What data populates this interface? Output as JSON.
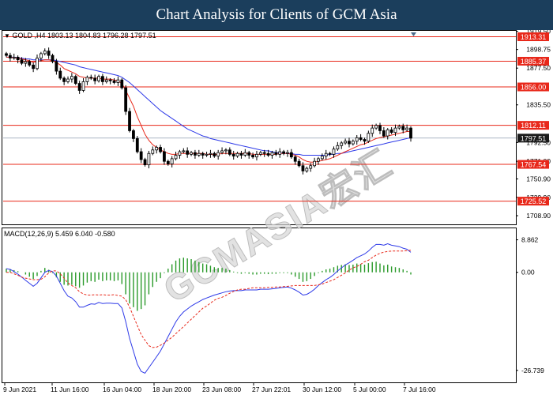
{
  "header": {
    "title": "Chart Analysis for Clients of GCM Asia"
  },
  "symbol_info": "GOLD ,H4  1803.13 1804.83 1796.28 1797.51",
  "macd_info": "MACD(12,26,9) 5.459 6.040 -0.580",
  "watermark": "GCMASIA宏汇",
  "colors": {
    "header_bg": "#1b3e5c",
    "level_line": "#e8281a",
    "level_tag": "#e8281a",
    "price_tag": "#1a1a1a",
    "ma_fast": "#e8281a",
    "ma_slow": "#2d39e8",
    "macd_hist": "#2a9a2a",
    "macd_line": "#2d39e8",
    "signal_line": "#e8281a",
    "candle": "#000000"
  },
  "chart_data": {
    "type": "candlestick",
    "price_axis": {
      "min": 1699,
      "max": 1921,
      "ticks": [
        "1919.50",
        "1898.75",
        "1877.50",
        "1835.50",
        "1792.50",
        "1771.00",
        "1750.90",
        "1729.90",
        "1708.90"
      ]
    },
    "levels": [
      1913.31,
      1885.37,
      1856.0,
      1812.11,
      1767.54,
      1725.52
    ],
    "current_price": 1797.51,
    "x_labels": [
      "9 Jun 2021",
      "11 Jun 16:00",
      "16 Jun 04:00",
      "18 Jun 20:00",
      "23 Jun 08:00",
      "27 Jun 22:01",
      "30 Jun 12:00",
      "5 Jul 00:00",
      "7 Jul 16:00"
    ],
    "close": [
      1892,
      1889,
      1890,
      1887,
      1883,
      1885,
      1881,
      1877,
      1889,
      1894,
      1897,
      1892,
      1885,
      1874,
      1866,
      1862,
      1865,
      1868,
      1860,
      1852,
      1862,
      1867,
      1866,
      1863,
      1868,
      1862,
      1864,
      1863,
      1861,
      1864,
      1855,
      1828,
      1806,
      1797,
      1782,
      1773,
      1767,
      1780,
      1784,
      1787,
      1782,
      1771,
      1768,
      1774,
      1778,
      1782,
      1783,
      1779,
      1781,
      1778,
      1780,
      1778,
      1779,
      1780,
      1777,
      1781,
      1783,
      1784,
      1779,
      1777,
      1780,
      1778,
      1781,
      1778,
      1776,
      1779,
      1781,
      1780,
      1778,
      1781,
      1779,
      1782,
      1780,
      1781,
      1776,
      1771,
      1766,
      1760,
      1763,
      1766,
      1771,
      1774,
      1777,
      1780,
      1779,
      1785,
      1789,
      1792,
      1794,
      1791,
      1794,
      1798,
      1796,
      1794,
      1803,
      1809,
      1812,
      1806,
      1800,
      1807,
      1804,
      1809,
      1811,
      1807,
      1809,
      1797.51
    ],
    "ma_fast": [
      1890,
      1890,
      1889,
      1889,
      1888,
      1887,
      1886,
      1884,
      1885,
      1886,
      1887,
      1887,
      1886,
      1884,
      1881,
      1877,
      1875,
      1873,
      1871,
      1868,
      1867,
      1866,
      1866,
      1866,
      1866,
      1865,
      1865,
      1865,
      1864,
      1863,
      1860,
      1852,
      1843,
      1834,
      1822,
      1812,
      1802,
      1795,
      1790,
      1787,
      1784,
      1782,
      1780,
      1779,
      1779,
      1780,
      1780,
      1780,
      1780,
      1780,
      1780,
      1780,
      1779,
      1779,
      1779,
      1779,
      1780,
      1780,
      1780,
      1780,
      1780,
      1780,
      1780,
      1780,
      1779,
      1779,
      1779,
      1779,
      1779,
      1779,
      1779,
      1780,
      1780,
      1780,
      1779,
      1778,
      1776,
      1773,
      1771,
      1770,
      1770,
      1771,
      1772,
      1773,
      1774,
      1776,
      1778,
      1780,
      1782,
      1784,
      1786,
      1788,
      1790,
      1791,
      1793,
      1795,
      1797,
      1798,
      1799,
      1800,
      1801,
      1802,
      1803,
      1804,
      1805,
      1805
    ],
    "ma_slow": [
      1890,
      1890,
      1890,
      1889,
      1889,
      1888,
      1888,
      1887,
      1887,
      1887,
      1887,
      1887,
      1887,
      1886,
      1885,
      1884,
      1883,
      1882,
      1881,
      1879,
      1878,
      1877,
      1876,
      1875,
      1874,
      1873,
      1872,
      1871,
      1870,
      1869,
      1867,
      1864,
      1861,
      1857,
      1853,
      1849,
      1845,
      1841,
      1837,
      1833,
      1829,
      1826,
      1823,
      1820,
      1817,
      1814,
      1811,
      1808,
      1806,
      1804,
      1802,
      1800,
      1799,
      1797,
      1796,
      1795,
      1794,
      1793,
      1792,
      1791,
      1790,
      1789,
      1788,
      1787,
      1786,
      1785,
      1784,
      1783,
      1783,
      1782,
      1781,
      1781,
      1780,
      1780,
      1780,
      1779,
      1779,
      1778,
      1778,
      1778,
      1778,
      1778,
      1778,
      1778,
      1779,
      1779,
      1780,
      1780,
      1781,
      1782,
      1783,
      1784,
      1785,
      1786,
      1787,
      1788,
      1789,
      1790,
      1791,
      1792,
      1793,
      1794,
      1795,
      1796,
      1797,
      1798
    ],
    "macd_axis": {
      "min": -30,
      "max": 12,
      "ticks": [
        "8.862",
        "0.00",
        "-26.739"
      ]
    },
    "macd_hist": [
      1,
      0.8,
      0.6,
      0.3,
      0,
      -0.6,
      -1.2,
      -1.8,
      -1,
      0.4,
      1.2,
      0.7,
      -0.2,
      -1.4,
      -2.6,
      -3.4,
      -3.6,
      -3.4,
      -3.8,
      -4.2,
      -3.6,
      -2.8,
      -2.4,
      -2.6,
      -2,
      -2.4,
      -2.2,
      -2.2,
      -2.4,
      -2.2,
      -3.2,
      -6,
      -8.5,
      -9.5,
      -10.5,
      -10,
      -9,
      -6,
      -4,
      -2.6,
      -1.6,
      -0.2,
      1,
      2.2,
      3.2,
      3.8,
      4,
      3.8,
      3.6,
      3.2,
      2.8,
      2.4,
      2.2,
      1.8,
      1.4,
      1.2,
      1.2,
      1,
      0.6,
      0.2,
      -0.2,
      -0.4,
      -0.2,
      -0.4,
      -0.6,
      -0.6,
      -0.4,
      -0.4,
      -0.5,
      -0.4,
      -0.4,
      -0.2,
      -0.2,
      -0.2,
      -0.6,
      -1.2,
      -1.8,
      -2.6,
      -2.4,
      -1.8,
      -1,
      -0.2,
      0.4,
      0.8,
      1,
      1.4,
      1.8,
      2,
      2.2,
      2,
      2.1,
      2.4,
      2.3,
      2.1,
      2.5,
      2.8,
      2.9,
      2.4,
      1.9,
      2.1,
      1.6,
      1.4,
      1.2,
      0.8,
      0.4,
      -0.6
    ],
    "macd_line": [
      1,
      0.8,
      0.2,
      -0.5,
      -1.3,
      -2.2,
      -3,
      -3.8,
      -3,
      -1.5,
      0,
      0.5,
      0.2,
      -1,
      -3,
      -5,
      -6.5,
      -7,
      -8,
      -9.5,
      -9.5,
      -9,
      -8.6,
      -8.7,
      -8.2,
      -8.5,
      -8.4,
      -8.4,
      -8.5,
      -8.5,
      -9.7,
      -13.5,
      -18,
      -21.5,
      -25,
      -27,
      -27.5,
      -26,
      -24.5,
      -23,
      -21.5,
      -19.5,
      -17.5,
      -15.5,
      -13.5,
      -12,
      -10.8,
      -10,
      -9.2,
      -8.6,
      -8,
      -7.4,
      -7,
      -6.6,
      -6.2,
      -5.9,
      -5.6,
      -5.3,
      -5.1,
      -5,
      -5,
      -5,
      -4.8,
      -4.8,
      -4.8,
      -4.8,
      -4.6,
      -4.6,
      -4.6,
      -4.5,
      -4.4,
      -4.2,
      -4.1,
      -4,
      -4.3,
      -4.8,
      -5.4,
      -6.2,
      -6,
      -5.4,
      -4.6,
      -3.6,
      -2.8,
      -2,
      -1.4,
      -0.6,
      0.4,
      1.2,
      2,
      2.6,
      3.3,
      4,
      4.5,
      5,
      5.8,
      6.8,
      7.6,
      7.6,
      7.4,
      7.8,
      7.4,
      7.2,
      7,
      6.6,
      6.3,
      5.46
    ],
    "signal_line": [
      0,
      0,
      -0.4,
      -0.8,
      -1.3,
      -1.6,
      -1.8,
      -2,
      -2,
      -1.9,
      -1.2,
      -0.2,
      0.4,
      0.4,
      -0.4,
      -1.6,
      -2.9,
      -3.6,
      -4.2,
      -5.3,
      -5.9,
      -6.2,
      -6.2,
      -6.1,
      -6.2,
      -6.1,
      -6.2,
      -6.2,
      -6.1,
      -6.3,
      -6.5,
      -7.5,
      -9.5,
      -12,
      -14.5,
      -17,
      -18.5,
      -20,
      -20.5,
      -20.4,
      -19.9,
      -19.3,
      -18.5,
      -17.7,
      -16.7,
      -15.8,
      -14.8,
      -13.8,
      -12.8,
      -11.8,
      -10.8,
      -9.8,
      -9.2,
      -8.4,
      -7.6,
      -7.1,
      -6.8,
      -6.3,
      -5.7,
      -5.2,
      -4.8,
      -4.6,
      -4.6,
      -4.4,
      -4.2,
      -4.2,
      -4.2,
      -4.2,
      -4.1,
      -4.1,
      -4,
      -4,
      -3.9,
      -3.8,
      -3.7,
      -3.6,
      -3.6,
      -3.6,
      -3.6,
      -3.6,
      -3.6,
      -3.4,
      -3.2,
      -2.8,
      -2.4,
      -2,
      -1.4,
      -0.8,
      -0.2,
      0.6,
      1.2,
      1.6,
      2.2,
      2.9,
      3.3,
      4,
      4.7,
      5.2,
      5.5,
      5.7,
      5.8,
      5.8,
      5.8,
      5.8,
      5.9,
      6.04
    ]
  }
}
